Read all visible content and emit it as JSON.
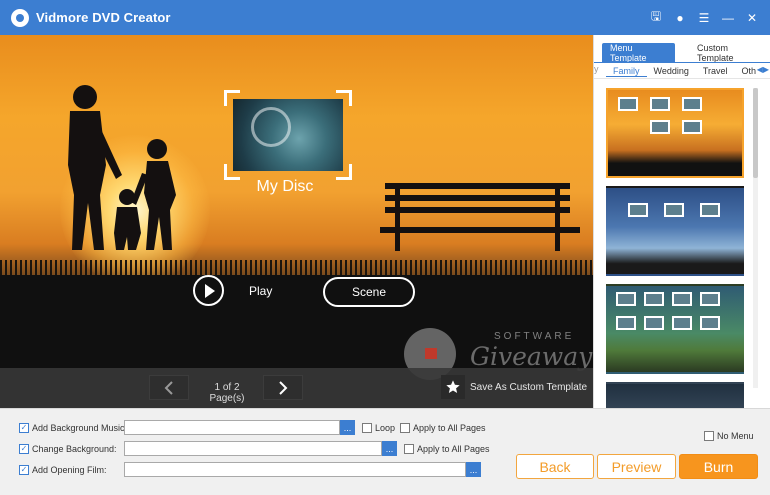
{
  "app": {
    "title": "Vidmore DVD Creator",
    "accent_color": "#3c7ed1",
    "action_color": "#f7951e",
    "window_controls": [
      "save-icon",
      "feedback-icon",
      "menu-icon",
      "minimize-icon",
      "close-icon"
    ],
    "window_control_glyphs": [
      "🖫",
      "●",
      "☰",
      "—",
      "✕"
    ]
  },
  "preview": {
    "disc_title": "My Disc",
    "play_label": "Play",
    "scene_label": "Scene",
    "pager_text": "1 of 2 Page(s)",
    "save_template_label": "Save As Custom Template",
    "watermark_small": "SOFTWARE",
    "watermark_big": "Giveaway"
  },
  "panel": {
    "tabs": [
      {
        "label": "Menu Template",
        "active": true
      },
      {
        "label": "Custom Template",
        "active": false
      }
    ],
    "categories": [
      "Family",
      "Wedding",
      "Travel",
      "Oth"
    ],
    "active_category": "Family",
    "left_fade": "y",
    "arrows": "◀▶"
  },
  "options": {
    "bg_music": {
      "label": "Add Background Music:",
      "checked": true,
      "value": ""
    },
    "loop": {
      "label": "Loop",
      "checked": false
    },
    "apply_music_all": {
      "label": "Apply to All Pages",
      "checked": false
    },
    "bg_change": {
      "label": "Change Background:",
      "checked": true,
      "value": ""
    },
    "apply_bg_all": {
      "label": "Apply to All Pages",
      "checked": false
    },
    "opening_film": {
      "label": "Add Opening Film:",
      "checked": true,
      "value": ""
    },
    "no_menu": {
      "label": "No Menu",
      "checked": false
    },
    "browse": "..."
  },
  "actions": {
    "back": "Back",
    "preview": "Preview",
    "burn": "Burn"
  }
}
